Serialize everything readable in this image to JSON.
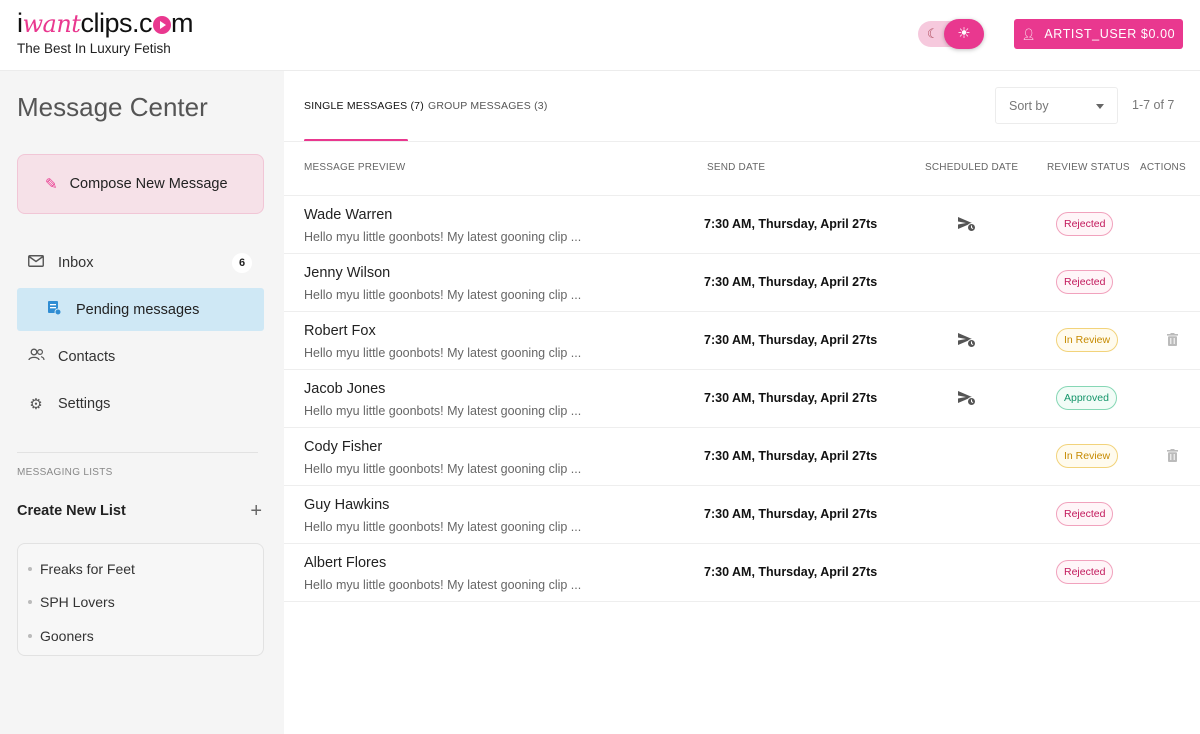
{
  "header": {
    "logo_prefix": "i",
    "logo_accent": "want",
    "logo_suffix": "clips.c",
    "logo_end": "m",
    "tagline": "The Best In Luxury Fetish",
    "user_button": "ARTIST_USER $0.00",
    "theme_toggle_icons": [
      "moon-icon",
      "sun-icon"
    ]
  },
  "sidebar": {
    "title": "Message Center",
    "compose": "Compose New Message",
    "nav": [
      {
        "label": "Inbox",
        "icon": "mail-icon",
        "badge": "6"
      },
      {
        "label": "Pending messages",
        "icon": "pending-document-icon",
        "active": true
      },
      {
        "label": "Contacts",
        "icon": "contacts-icon"
      },
      {
        "label": "Settings",
        "icon": "gear-icon"
      }
    ],
    "lists_label": "MESSAGING LISTS",
    "create_list": "Create New List",
    "lists": [
      "Freaks for Feet",
      "SPH Lovers",
      "Gooners"
    ]
  },
  "main": {
    "tabs": [
      {
        "label": "SINGLE MESSAGES (7)",
        "active": true
      },
      {
        "label": "GROUP MESSAGES (3)",
        "active": false
      }
    ],
    "sort_label": "Sort by",
    "pager": "1-7 of 7",
    "columns": [
      "MESSAGE PREVIEW",
      "SEND DATE",
      "SCHEDULED DATE",
      "REVIEW STATUS",
      "ACTIONS"
    ],
    "rows": [
      {
        "name": "Wade Warren",
        "preview": "Hello myu little goonbots! My latest gooning clip ...",
        "send_date": "7:30 AM, Thursday, April 27ts",
        "scheduled": true,
        "status": "Rejected",
        "status_kind": "rejected",
        "delete": false
      },
      {
        "name": "Jenny Wilson",
        "preview": "Hello myu little goonbots! My latest gooning clip ...",
        "send_date": "7:30 AM, Thursday, April 27ts",
        "scheduled": false,
        "status": "Rejected",
        "status_kind": "rejected",
        "delete": false
      },
      {
        "name": "Robert Fox",
        "preview": "Hello myu little goonbots! My latest gooning clip ...",
        "send_date": "7:30 AM, Thursday, April 27ts",
        "scheduled": true,
        "status": "In Review",
        "status_kind": "review",
        "delete": true
      },
      {
        "name": "Jacob Jones",
        "preview": "Hello myu little goonbots! My latest gooning clip ...",
        "send_date": "7:30 AM, Thursday, April 27ts",
        "scheduled": true,
        "status": "Approved",
        "status_kind": "approved",
        "delete": false
      },
      {
        "name": "Cody Fisher",
        "preview": "Hello myu little goonbots! My latest gooning clip ...",
        "send_date": "7:30 AM, Thursday, April 27ts",
        "scheduled": false,
        "status": "In Review",
        "status_kind": "review",
        "delete": true
      },
      {
        "name": "Guy Hawkins",
        "preview": "Hello myu little goonbots! My latest gooning clip ...",
        "send_date": "7:30 AM, Thursday, April 27ts",
        "scheduled": false,
        "status": "Rejected",
        "status_kind": "rejected",
        "delete": false
      },
      {
        "name": "Albert Flores",
        "preview": "Hello myu little goonbots! My latest gooning clip ...",
        "send_date": "7:30 AM, Thursday, April 27ts",
        "scheduled": false,
        "status": "Rejected",
        "status_kind": "rejected",
        "delete": false
      }
    ]
  },
  "colors": {
    "brand": "#e9388f",
    "active_nav": "#cfe8f5",
    "compose_bg": "#f6e1e8"
  }
}
